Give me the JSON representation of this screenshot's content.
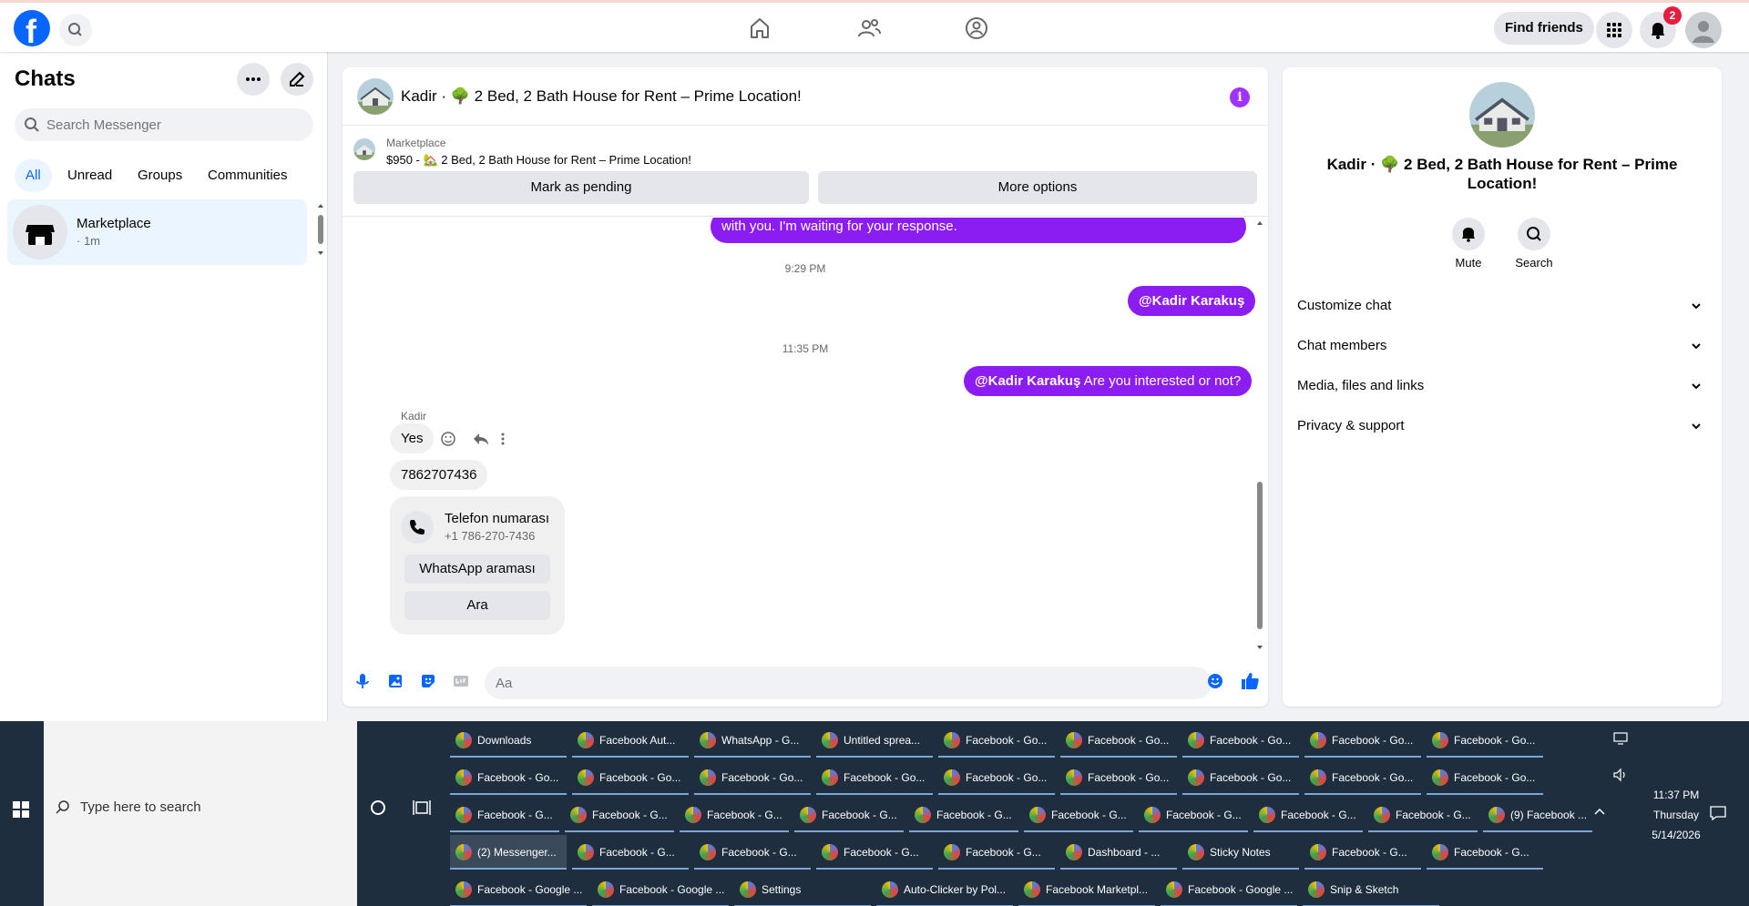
{
  "topbar": {
    "find_friends": "Find friends",
    "notification_count": "2"
  },
  "sidebar": {
    "title": "Chats",
    "search_placeholder": "Search Messenger",
    "filters": [
      "All",
      "Unread",
      "Groups",
      "Communities"
    ],
    "chat": {
      "name": "Marketplace",
      "time": "· 1m"
    }
  },
  "chat": {
    "title": "Kadir · 🌳 2 Bed, 2 Bath House for Rent – Prime Location!",
    "marketplace_label": "Marketplace",
    "listing": "$950 - 🏡 2 Bed, 2 Bath House for Rent – Prime Location!",
    "mark_pending": "Mark as pending",
    "more_options": "More options",
    "msg_partial": "with you. I'm waiting for your response.",
    "time1": "9:29 PM",
    "mention1": "@Kadir Karakuş",
    "time2": "11:35 PM",
    "mention2": "@Kadir Karakuş",
    "msg2_text": " Are you interested or not?",
    "sender": "Kadir",
    "reply_yes": "Yes",
    "reply_number": "7862707436",
    "card_title": "Telefon numarası",
    "card_phone": "+1 786-270-7436",
    "card_whatsapp": "WhatsApp araması",
    "card_call": "Ara",
    "composer_placeholder": "Aa"
  },
  "details": {
    "title": "Kadir · 🌳 2 Bed, 2 Bath House for Rent – Prime Location!",
    "mute": "Mute",
    "search": "Search",
    "sections": [
      "Customize chat",
      "Chat members",
      "Media, files and links",
      "Privacy & support"
    ]
  },
  "taskbar": {
    "search_placeholder": "Type here to search",
    "time": "11:37 PM",
    "day": "Thursday",
    "date": "5/14/2026",
    "row1": [
      "Downloads",
      "Facebook Aut...",
      "WhatsApp - G...",
      "Untitled sprea...",
      "Facebook - Go...",
      "Facebook - Go...",
      "Facebook - Go...",
      "Facebook - Go...",
      "Facebook - Go..."
    ],
    "row2": [
      "Facebook - Go...",
      "Facebook - Go...",
      "Facebook - Go...",
      "Facebook - Go...",
      "Facebook - Go...",
      "Facebook - Go...",
      "Facebook - Go...",
      "Facebook - Go...",
      "Facebook - Go..."
    ],
    "row3": [
      "Facebook - G...",
      "Facebook - G...",
      "Facebook - G...",
      "Facebook - G...",
      "Facebook - G...",
      "Facebook - G...",
      "Facebook - G...",
      "Facebook - G...",
      "Facebook - G...",
      "(9) Facebook ..."
    ],
    "row4": [
      "(2) Messenger...",
      "Facebook - G...",
      "Facebook - G...",
      "Facebook - G...",
      "Facebook - G...",
      "Dashboard - ...",
      "Sticky Notes",
      "Facebook - G...",
      "Facebook - G..."
    ],
    "row5": [
      "Facebook - Google ...",
      "Facebook - Google ...",
      "Settings",
      "Auto-Clicker by Pol...",
      "Facebook Marketpl...",
      "Facebook - Google ...",
      "Snip & Sketch"
    ]
  }
}
